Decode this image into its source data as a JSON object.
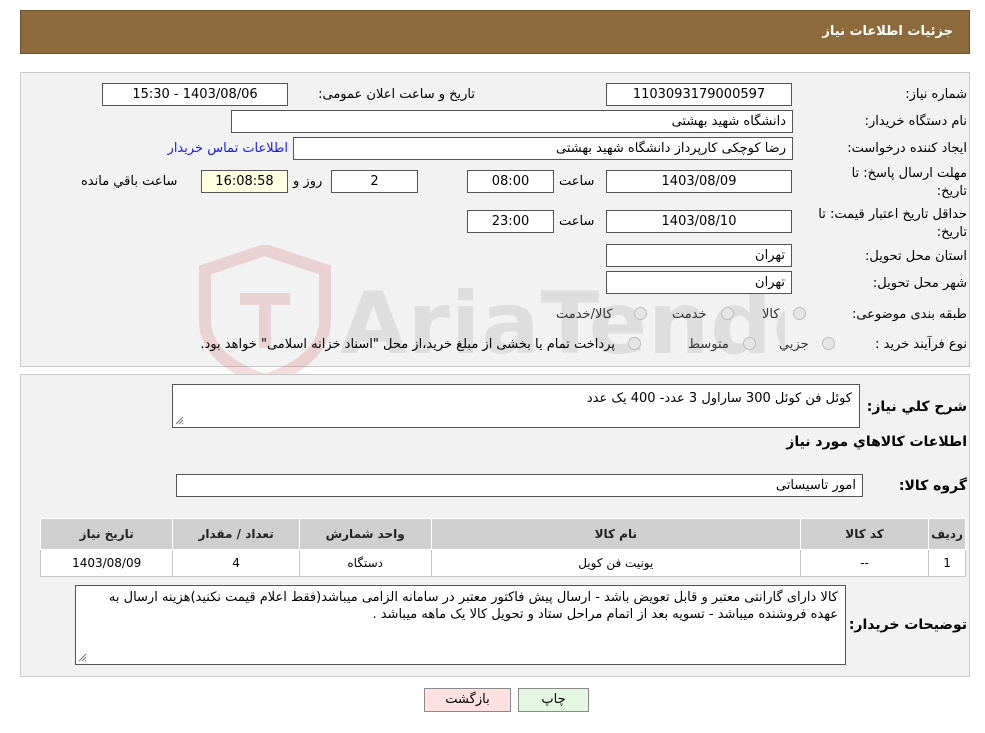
{
  "header": {
    "title": "جزئیات اطلاعات نیاز"
  },
  "watermark": {
    "text": "AriaTender.neT"
  },
  "info": {
    "need_number_label": "شماره نیاز:",
    "need_number": "1103093179000597",
    "announce_label": "تاریخ و ساعت اعلان عمومی:",
    "announce_value": "1403/08/06 - 15:30",
    "buyer_label": "نام دستگاه خریدار:",
    "buyer": "دانشگاه شهید بهشتی",
    "creator_label": "ایجاد کننده درخواست:",
    "creator": "رضا کوچکی کارپرداز دانشگاه شهید بهشتی",
    "contact_link": "اطلاعات تماس خریدار",
    "deadline_label_1": "مهلت ارسال پاسخ: تا",
    "deadline_label_2": "تاریخ:",
    "deadline_date": "1403/08/09",
    "time_label": "ساعت",
    "deadline_time": "08:00",
    "days_value": "2",
    "days_label": "روز و",
    "remaining_time": "16:08:58",
    "remaining_label": "ساعت باقي مانده",
    "validity_label_1": "حداقل تاریخ اعتبار قیمت: تا",
    "validity_label_2": "تاریخ:",
    "validity_date": "1403/08/10",
    "validity_time": "23:00",
    "province_label": "استان محل تحویل:",
    "province": "تهران",
    "city_label": "شهر محل تحویل:",
    "city": "تهران",
    "category_label": "طبقه بندی موضوعی:",
    "category_options": [
      "کالا",
      "خدمت",
      "کالا/خدمت"
    ],
    "process_label": "نوع فرآیند خرید :",
    "process_options": [
      "جزیي",
      "متوسط"
    ],
    "process_note": "پرداخت تمام یا بخشی از مبلغ خرید،از محل \"اسناد خزانه اسلامی\" خواهد بود."
  },
  "details": {
    "description_label": "شرح کلي نیاز:",
    "description": "کوئل فن کوئل 300 ساراول 3 عدد- 400 یک عدد",
    "goods_info_title": "اطلاعات کالاهاي مورد نیاز",
    "group_label": "گروه کالا:",
    "group_value": "امور تاسیساتی",
    "table": {
      "headers": [
        "ردیف",
        "کد کالا",
        "نام کالا",
        "واحد شمارش",
        "تعداد / مقدار",
        "تاریخ نیاز"
      ],
      "rows": [
        [
          "1",
          "--",
          "یونیت فن کویل",
          "دستگاه",
          "4",
          "1403/08/09"
        ]
      ]
    },
    "buyer_notes_label": "توضیحات خریدار:",
    "buyer_notes": "کالا دارای گارانتی معتبر و قابل تعویض باشد - ارسال پیش فاکتور معتبر در سامانه الزامی میباشد(فقط اعلام قیمت نکنید)هزینه ارسال به عهده فروشنده میباشد - تسویه بعد از اتمام مراحل ستاد و تحویل کالا یک ماهه میباشد ."
  },
  "buttons": {
    "print": "چاپ",
    "back": "بازگشت"
  },
  "colors": {
    "header_bg": "#8d6a3b",
    "back_button_bg": "#fde1e1",
    "print_button_bg": "#e4f7e1",
    "link": "#1a1aee"
  }
}
